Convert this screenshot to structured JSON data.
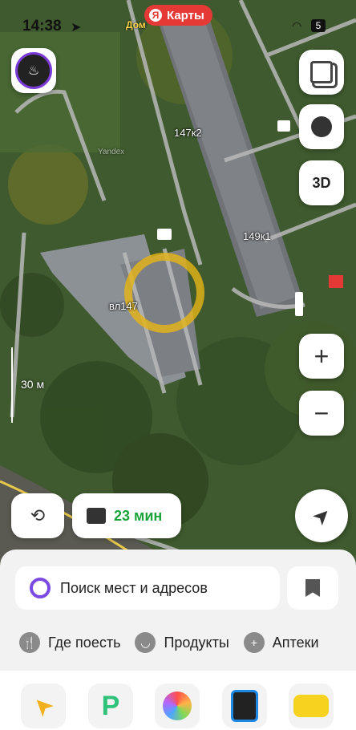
{
  "status": {
    "time": "14:38",
    "battery": "5"
  },
  "header": {
    "app_pill": "Карты",
    "home_label": "Дом"
  },
  "map": {
    "labels": {
      "b1": "147к2",
      "b2": "149к1",
      "b3": "вл147",
      "watermark": "Yandex"
    },
    "scale": "30 м",
    "layers_3d": "3D"
  },
  "route": {
    "eta": "23 мин"
  },
  "search": {
    "placeholder": "Поиск мест и адресов"
  },
  "categories": [
    {
      "label": "Где поесть"
    },
    {
      "label": "Продукты"
    },
    {
      "label": "Аптеки"
    }
  ]
}
